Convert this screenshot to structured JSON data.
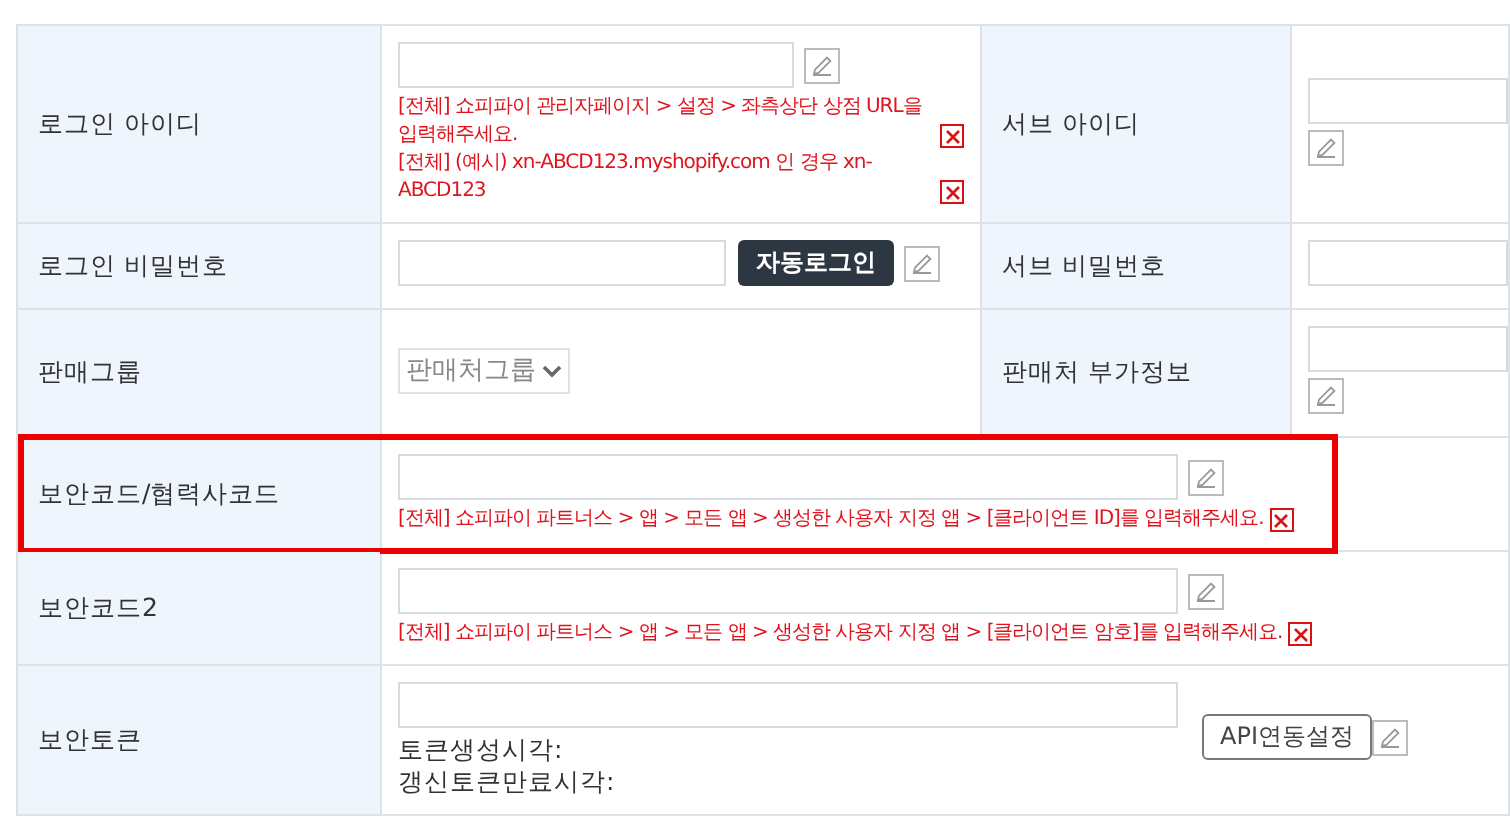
{
  "rows": [
    {
      "highlighted": false,
      "cells": [
        {
          "kind": "label",
          "text": "로그인 아이디"
        },
        {
          "kind": "value",
          "items": [
            {
              "kind": "input"
            },
            {
              "kind": "edit"
            },
            {
              "kind": "hint",
              "text": "[전체] 쇼피파이 관리자페이지 > 설정 > 좌측상단 상점 URL을 입력해주세요."
            },
            {
              "kind": "hint",
              "text": "[전체] (예시) xn-ABCD123.myshopify.com 인 경우 xn-ABCD123"
            }
          ]
        },
        {
          "kind": "label",
          "text": "서브 아이디"
        },
        {
          "kind": "value",
          "items": [
            {
              "kind": "input"
            },
            {
              "kind": "edit"
            }
          ]
        }
      ]
    },
    {
      "highlighted": false,
      "cells": [
        {
          "kind": "label",
          "text": "로그인 비밀번호"
        },
        {
          "kind": "value",
          "items": [
            {
              "kind": "input"
            },
            {
              "kind": "button",
              "text": "자동로그인"
            },
            {
              "kind": "edit"
            }
          ]
        },
        {
          "kind": "label",
          "text": "서브 비밀번호"
        },
        {
          "kind": "value",
          "items": [
            {
              "kind": "input"
            }
          ]
        }
      ]
    },
    {
      "highlighted": false,
      "cells": [
        {
          "kind": "label",
          "text": "판매그룹"
        },
        {
          "kind": "value",
          "items": [
            {
              "kind": "select",
              "text": "판매처그룹"
            }
          ]
        },
        {
          "kind": "label",
          "text": "판매처 부가정보"
        },
        {
          "kind": "value",
          "items": [
            {
              "kind": "input"
            },
            {
              "kind": "edit"
            }
          ]
        }
      ]
    },
    {
      "highlighted": true,
      "cells": [
        {
          "kind": "label",
          "text": "보안코드/협력사코드"
        },
        {
          "kind": "value",
          "items": [
            {
              "kind": "input"
            },
            {
              "kind": "edit"
            },
            {
              "kind": "hint",
              "text": "[전체] 쇼피파이 파트너스 > 앱 > 모든 앱 > 생성한 사용자 지정 앱 > [클라이언트 ID]를 입력해주세요."
            }
          ]
        }
      ]
    },
    {
      "highlighted": false,
      "cells": [
        {
          "kind": "label",
          "text": "보안코드2"
        },
        {
          "kind": "value",
          "items": [
            {
              "kind": "input"
            },
            {
              "kind": "edit"
            },
            {
              "kind": "hint",
              "text": "[전체] 쇼피파이 파트너스 > 앱 > 모든 앱 > 생성한 사용자 지정 앱 > [클라이언트 암호]를 입력해주세요."
            }
          ]
        }
      ]
    },
    {
      "highlighted": false,
      "cells": [
        {
          "kind": "label",
          "text": "보안토큰"
        },
        {
          "kind": "value",
          "items": [
            {
              "kind": "input"
            },
            {
              "kind": "note",
              "text": "토큰생성시각:"
            },
            {
              "kind": "note",
              "text": "갱신토큰만료시각:"
            }
          ],
          "side": [
            {
              "kind": "button",
              "text": "API연동설정"
            },
            {
              "kind": "edit"
            }
          ]
        }
      ]
    }
  ]
}
